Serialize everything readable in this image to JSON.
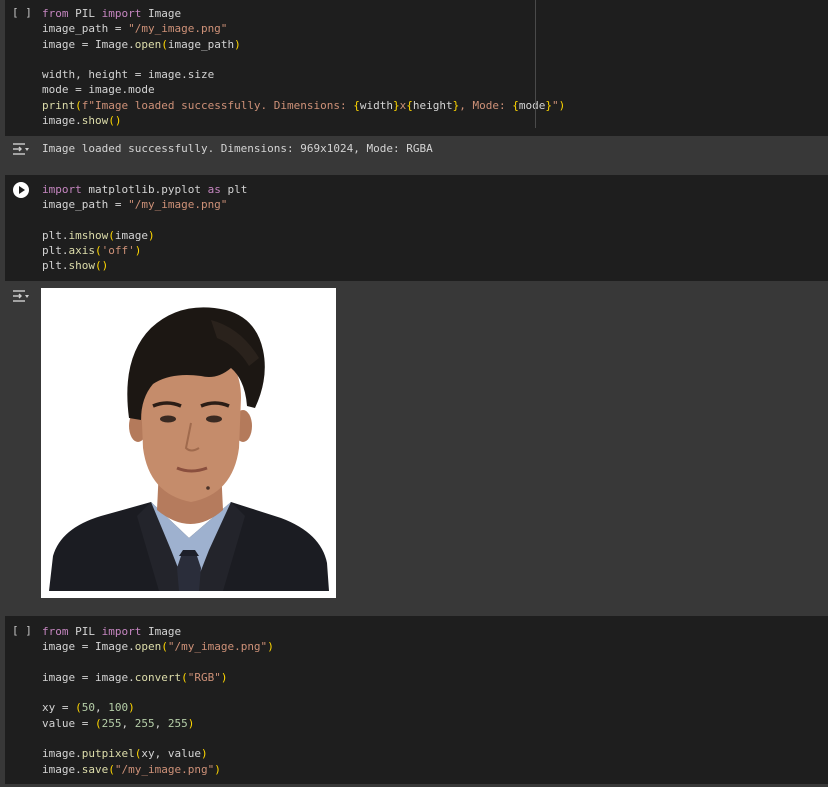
{
  "cells": {
    "cell1": {
      "bracket": "[ ]",
      "lines": [
        [
          {
            "c": "kw",
            "t": "from"
          },
          {
            "c": "txt",
            "t": " PIL "
          },
          {
            "c": "kw",
            "t": "import"
          },
          {
            "c": "txt",
            "t": " Image"
          }
        ],
        [
          {
            "c": "txt",
            "t": "image_path = "
          },
          {
            "c": "str",
            "t": "\"/my_image.png\""
          }
        ],
        [
          {
            "c": "txt",
            "t": "image = Image."
          },
          {
            "c": "fn",
            "t": "open"
          },
          {
            "c": "par",
            "t": "("
          },
          {
            "c": "txt",
            "t": "image_path"
          },
          {
            "c": "par",
            "t": ")"
          }
        ],
        [],
        [
          {
            "c": "txt",
            "t": "width, height = image.size"
          }
        ],
        [
          {
            "c": "txt",
            "t": "mode = image.mode"
          }
        ],
        [
          {
            "c": "fn",
            "t": "print"
          },
          {
            "c": "par",
            "t": "("
          },
          {
            "c": "str",
            "t": "f\"Image loaded successfully. Dimensions: "
          },
          {
            "c": "par",
            "t": "{"
          },
          {
            "c": "txt",
            "t": "width"
          },
          {
            "c": "par",
            "t": "}"
          },
          {
            "c": "str",
            "t": "x"
          },
          {
            "c": "par",
            "t": "{"
          },
          {
            "c": "txt",
            "t": "height"
          },
          {
            "c": "par",
            "t": "}"
          },
          {
            "c": "str",
            "t": ", Mode: "
          },
          {
            "c": "par",
            "t": "{"
          },
          {
            "c": "txt",
            "t": "mode"
          },
          {
            "c": "par",
            "t": "}"
          },
          {
            "c": "str",
            "t": "\""
          },
          {
            "c": "par",
            "t": ")"
          }
        ],
        [
          {
            "c": "txt",
            "t": "image."
          },
          {
            "c": "fn",
            "t": "show"
          },
          {
            "c": "par",
            "t": "()"
          }
        ]
      ]
    },
    "output1": "Image loaded successfully. Dimensions: 969x1024, Mode: RGBA",
    "cell2": {
      "lines": [
        [
          {
            "c": "kw",
            "t": "import"
          },
          {
            "c": "txt",
            "t": " matplotlib.pyplot "
          },
          {
            "c": "kw",
            "t": "as"
          },
          {
            "c": "txt",
            "t": " plt"
          }
        ],
        [
          {
            "c": "txt",
            "t": "image_path = "
          },
          {
            "c": "str",
            "t": "\"/my_image.png\""
          }
        ],
        [],
        [
          {
            "c": "txt",
            "t": "plt."
          },
          {
            "c": "fn",
            "t": "imshow"
          },
          {
            "c": "par",
            "t": "("
          },
          {
            "c": "txt",
            "t": "image"
          },
          {
            "c": "par",
            "t": ")"
          }
        ],
        [
          {
            "c": "txt",
            "t": "plt."
          },
          {
            "c": "fn",
            "t": "axis"
          },
          {
            "c": "par",
            "t": "("
          },
          {
            "c": "str",
            "t": "'off'"
          },
          {
            "c": "par",
            "t": ")"
          }
        ],
        [
          {
            "c": "txt",
            "t": "plt."
          },
          {
            "c": "fn",
            "t": "show"
          },
          {
            "c": "par",
            "t": "()"
          }
        ]
      ]
    },
    "cell3": {
      "bracket": "[ ]",
      "lines": [
        [
          {
            "c": "kw",
            "t": "from"
          },
          {
            "c": "txt",
            "t": " PIL "
          },
          {
            "c": "kw",
            "t": "import"
          },
          {
            "c": "txt",
            "t": " Image"
          }
        ],
        [
          {
            "c": "txt",
            "t": "image = Image."
          },
          {
            "c": "fn",
            "t": "open"
          },
          {
            "c": "par",
            "t": "("
          },
          {
            "c": "str",
            "t": "\"/my_image.png\""
          },
          {
            "c": "par",
            "t": ")"
          }
        ],
        [],
        [
          {
            "c": "txt",
            "t": "image = image."
          },
          {
            "c": "fn",
            "t": "convert"
          },
          {
            "c": "par",
            "t": "("
          },
          {
            "c": "str",
            "t": "\"RGB\""
          },
          {
            "c": "par",
            "t": ")"
          }
        ],
        [],
        [
          {
            "c": "txt",
            "t": "xy = "
          },
          {
            "c": "par",
            "t": "("
          },
          {
            "c": "num",
            "t": "50"
          },
          {
            "c": "txt",
            "t": ", "
          },
          {
            "c": "num",
            "t": "100"
          },
          {
            "c": "par",
            "t": ")"
          }
        ],
        [
          {
            "c": "txt",
            "t": "value = "
          },
          {
            "c": "par",
            "t": "("
          },
          {
            "c": "num",
            "t": "255"
          },
          {
            "c": "txt",
            "t": ", "
          },
          {
            "c": "num",
            "t": "255"
          },
          {
            "c": "txt",
            "t": ", "
          },
          {
            "c": "num",
            "t": "255"
          },
          {
            "c": "par",
            "t": ")"
          }
        ],
        [],
        [
          {
            "c": "txt",
            "t": "image."
          },
          {
            "c": "fn",
            "t": "putpixel"
          },
          {
            "c": "par",
            "t": "("
          },
          {
            "c": "txt",
            "t": "xy, value"
          },
          {
            "c": "par",
            "t": ")"
          }
        ],
        [
          {
            "c": "txt",
            "t": "image."
          },
          {
            "c": "fn",
            "t": "save"
          },
          {
            "c": "par",
            "t": "("
          },
          {
            "c": "str",
            "t": "\"/my_image.png\""
          },
          {
            "c": "par",
            "t": ")"
          }
        ]
      ]
    }
  },
  "icons": {
    "run": "play-circle-icon",
    "output": "output-toggle-icon",
    "image": "portrait-photo"
  }
}
